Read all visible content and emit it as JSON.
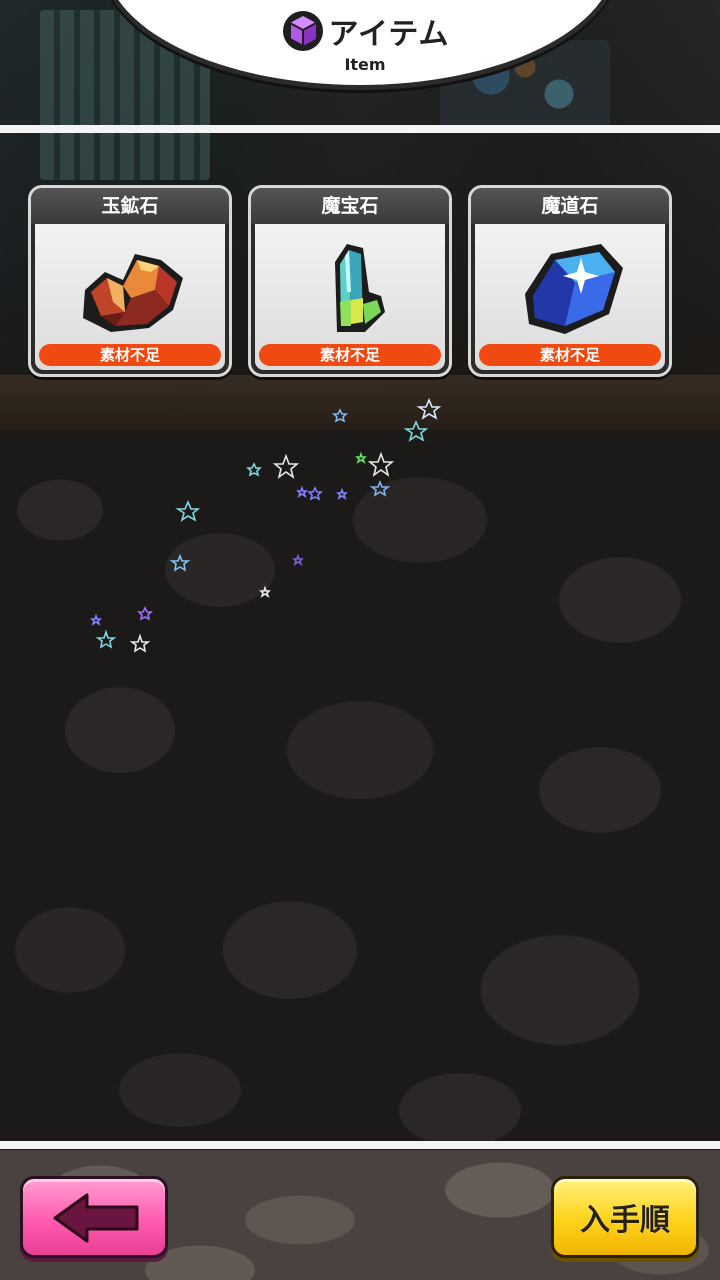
{
  "header": {
    "title": "アイテム",
    "subtitle": "Item",
    "icon": "purple-cube-icon",
    "accent_color": "#a64ad8"
  },
  "items": [
    {
      "name": "玉鉱石",
      "status": "素材不足",
      "icon": "orange-ore-icon"
    },
    {
      "name": "魔宝石",
      "status": "素材不足",
      "icon": "green-crystal-icon"
    },
    {
      "name": "魔道石",
      "status": "素材不足",
      "icon": "blue-magic-stone-icon"
    }
  ],
  "status_color": "#f04a12",
  "footer": {
    "back_icon": "back-arrow-icon",
    "back_color": "#ff5bb0",
    "sort_label": "入手順",
    "sort_color": "#ffd21c"
  }
}
